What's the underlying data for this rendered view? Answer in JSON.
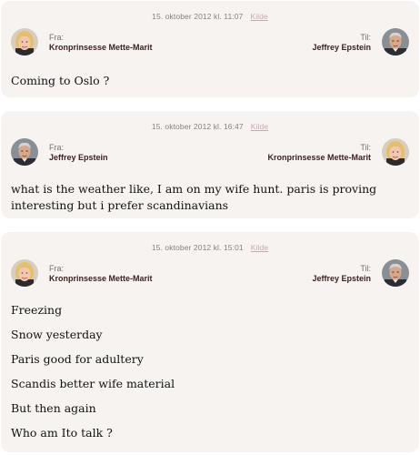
{
  "messages": [
    {
      "date": "15. oktober 2012 kl. 11:07",
      "source_label": "Kilde",
      "from_label": "Fra:",
      "from_name": "Kronprinsesse Mette-Marit",
      "to_label": "Til:",
      "to_name": "Jeffrey Epstein",
      "from_avatar": "woman-portrait",
      "to_avatar": "man-portrait",
      "body": "Coming to Oslo ?"
    },
    {
      "date": "15. oktober 2012 kl. 16:47",
      "source_label": "Kilde",
      "from_label": "Fra:",
      "from_name": "Jeffrey Epstein",
      "to_label": "Til:",
      "to_name": "Kronprinsesse Mette-Marit",
      "from_avatar": "man-portrait",
      "to_avatar": "woman-portrait",
      "body": "what is the weather like, I am on my wife hunt. paris is proving interesting but i prefer scandinavians"
    },
    {
      "date": "15. oktober 2012 kl. 15:01",
      "source_label": "Kilde",
      "from_label": "Fra:",
      "from_name": "Kronprinsesse Mette-Marit",
      "to_label": "Til:",
      "to_name": "Jeffrey Epstein",
      "from_avatar": "woman-portrait",
      "to_avatar": "man-portrait",
      "body_lines": [
        "Freezing",
        "Snow yesterday",
        "Paris good for adultery",
        "Scandis better wife material",
        "But then again",
        "Who am Ito talk ?"
      ]
    }
  ],
  "colors": {
    "card_bg": "#f7f3f1",
    "name": "#3a1f1f",
    "link": "#c9a8a8",
    "meta": "#8a7f7b"
  }
}
